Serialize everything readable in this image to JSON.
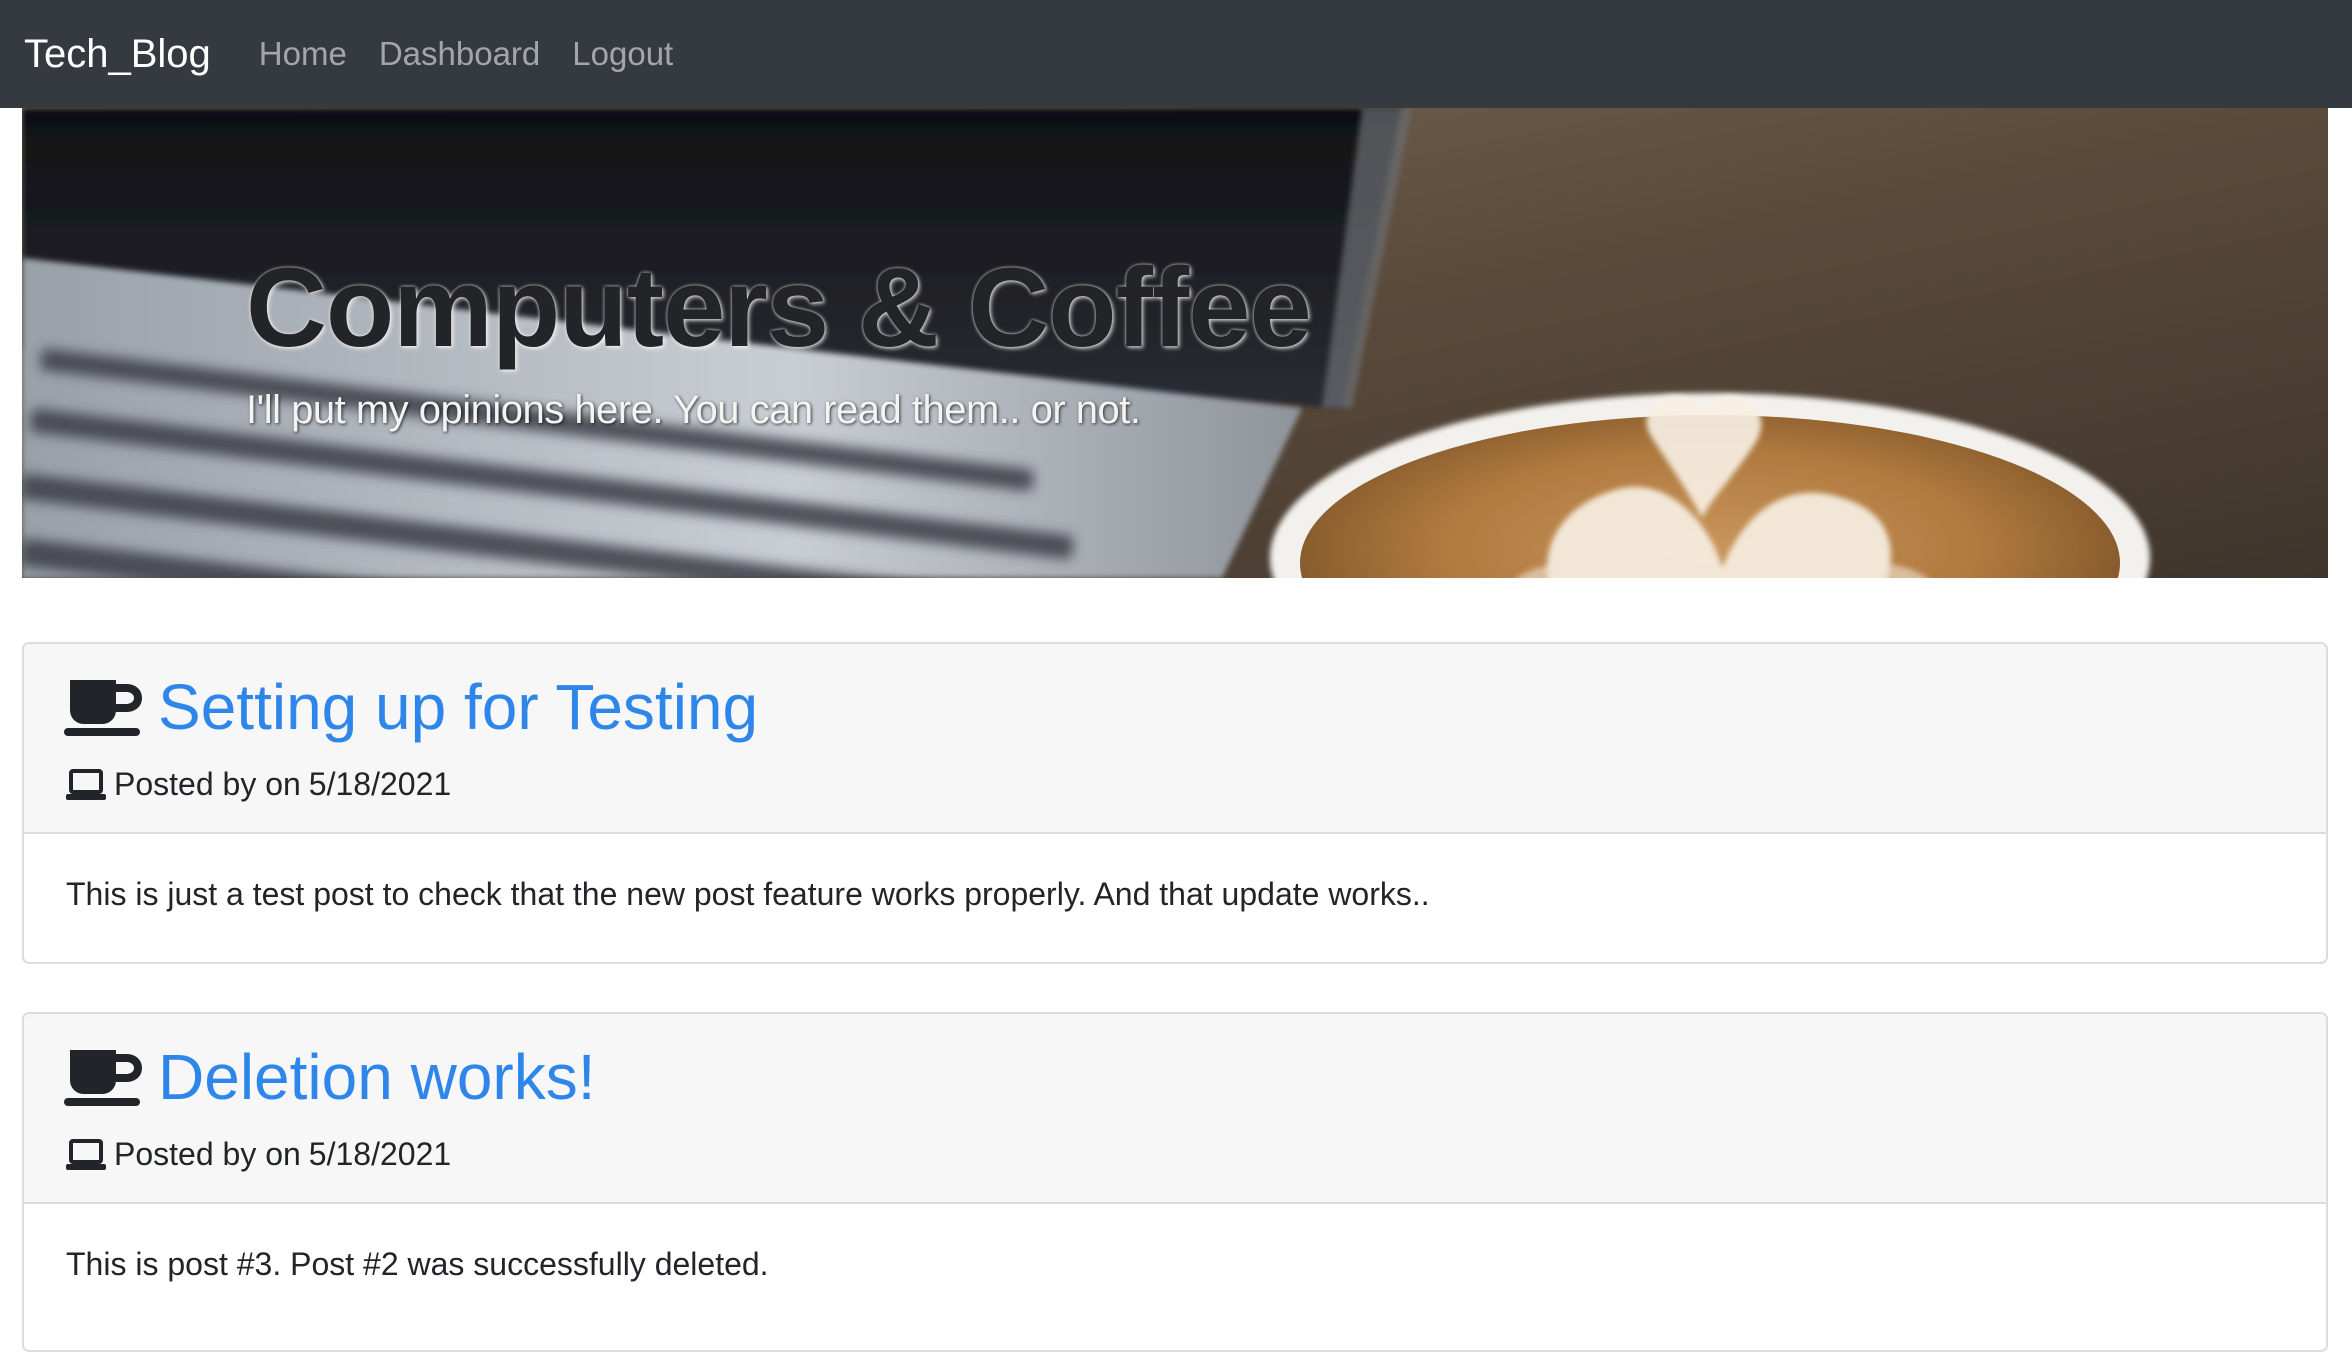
{
  "navbar": {
    "brand": "Tech_Blog",
    "links": [
      "Home",
      "Dashboard",
      "Logout"
    ]
  },
  "hero": {
    "title": "Computers & Coffee",
    "subtitle": "I'll put my opinions here. You can read them.. or not."
  },
  "posts": [
    {
      "title": "Setting up for Testing",
      "posted_by": "Posted by on",
      "date": "5/18/2021",
      "body": "This is just a test post to check that the new post feature works properly. And that update works.."
    },
    {
      "title": "Deletion works!",
      "posted_by": "Posted by on",
      "date": "5/18/2021",
      "body": "This is post #3. Post #2 was successfully deleted."
    }
  ],
  "icons": {
    "post_title_icon": "coffee-cup-icon",
    "meta_icon": "laptop-icon"
  },
  "colors": {
    "navbar": "#343a40",
    "link": "#2f86ea",
    "card_header": "#f7f7f7"
  }
}
